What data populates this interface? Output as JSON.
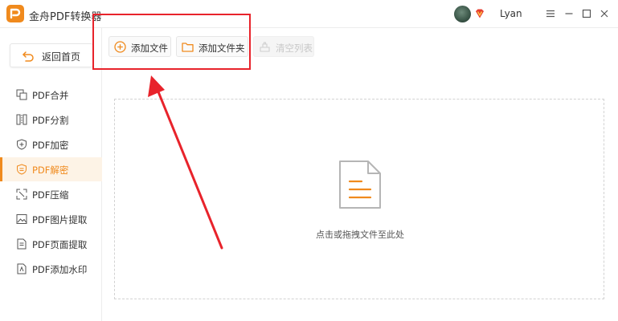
{
  "app": {
    "title": "金舟PDF转换器",
    "username": "Lyan",
    "accent_color": "#f08a1d",
    "annotation_color": "#e8232b"
  },
  "window_controls": [
    "menu-icon",
    "minimize-icon",
    "maximize-icon",
    "close-icon"
  ],
  "sidebar": {
    "back_label": "返回首页",
    "items": [
      {
        "label": "PDF合并",
        "icon": "merge-icon",
        "active": false
      },
      {
        "label": "PDF分割",
        "icon": "split-icon",
        "active": false
      },
      {
        "label": "PDF加密",
        "icon": "shield-plus-icon",
        "active": false
      },
      {
        "label": "PDF解密",
        "icon": "shield-check-icon",
        "active": true
      },
      {
        "label": "PDF压缩",
        "icon": "compress-icon",
        "active": false
      },
      {
        "label": "PDF图片提取",
        "icon": "image-icon",
        "active": false
      },
      {
        "label": "PDF页面提取",
        "icon": "page-icon",
        "active": false
      },
      {
        "label": "PDF添加水印",
        "icon": "watermark-icon",
        "active": false
      }
    ]
  },
  "toolbar": {
    "add_file_label": "添加文件",
    "add_folder_label": "添加文件夹",
    "clear_label": "清空列表"
  },
  "dropzone": {
    "hint": "点击或拖拽文件至此处",
    "icon": "document-icon"
  }
}
